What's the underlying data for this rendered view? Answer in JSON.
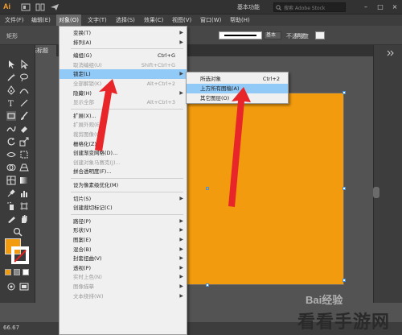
{
  "app": {
    "logo": "Ai",
    "workspace": "基本功能",
    "search_placeholder": "搜索 Adobe Stock"
  },
  "window_controls": [
    "–",
    "□",
    "×"
  ],
  "menubar": [
    "文件(F)",
    "编辑(E)",
    "对象(O)",
    "文字(T)",
    "选择(S)",
    "效果(C)",
    "视图(V)",
    "窗口(W)",
    "帮助(H)"
  ],
  "controlbar": {
    "left_label": "矩形",
    "stroke_style": "基本",
    "opacity_label": "不透明度",
    "style_label": "样式："
  },
  "doc_tab": "未标题",
  "object_menu": [
    {
      "label": "变换(T)",
      "submenu": true,
      "disabled": false
    },
    {
      "label": "排列(A)",
      "submenu": true,
      "disabled": false
    },
    {
      "sep": true
    },
    {
      "label": "编组(G)",
      "shortcut": "Ctrl+G",
      "disabled": false
    },
    {
      "label": "取消编组(U)",
      "shortcut": "Shift+Ctrl+G",
      "disabled": true
    },
    {
      "label": "锁定(L)",
      "submenu": true,
      "disabled": false,
      "highlight": true
    },
    {
      "label": "全部解锁(K)",
      "shortcut": "Alt+Ctrl+2",
      "disabled": true
    },
    {
      "label": "隐藏(H)",
      "submenu": true,
      "disabled": false
    },
    {
      "label": "显示全部",
      "shortcut": "Alt+Ctrl+3",
      "disabled": true
    },
    {
      "sep": true
    },
    {
      "label": "扩展(X)...",
      "disabled": false
    },
    {
      "label": "扩展外观(E)",
      "disabled": true
    },
    {
      "label": "裁剪图像(C)",
      "disabled": true
    },
    {
      "label": "栅格化(Z)...",
      "disabled": false
    },
    {
      "label": "创建渐变网格(D)...",
      "disabled": false
    },
    {
      "label": "创建对象马赛克(J)...",
      "disabled": true
    },
    {
      "label": "拼合透明度(F)...",
      "disabled": false
    },
    {
      "sep": true
    },
    {
      "label": "设为像素级优化(M)",
      "disabled": false
    },
    {
      "sep": true
    },
    {
      "label": "切片(S)",
      "submenu": true,
      "disabled": false
    },
    {
      "label": "创建裁切标记(C)",
      "disabled": false
    },
    {
      "sep": true
    },
    {
      "label": "路径(P)",
      "submenu": true,
      "disabled": false
    },
    {
      "label": "形状(V)",
      "submenu": true,
      "disabled": false
    },
    {
      "label": "图案(E)",
      "submenu": true,
      "disabled": false
    },
    {
      "label": "混合(B)",
      "submenu": true,
      "disabled": false
    },
    {
      "label": "封套扭曲(V)",
      "submenu": true,
      "disabled": false
    },
    {
      "label": "透视(P)",
      "submenu": true,
      "disabled": false
    },
    {
      "label": "实时上色(N)",
      "submenu": true,
      "disabled": true
    },
    {
      "label": "图像描摹",
      "submenu": true,
      "disabled": true
    },
    {
      "label": "文本绕排(W)",
      "submenu": true,
      "disabled": true
    }
  ],
  "lock_submenu": [
    {
      "label": "所选对象",
      "shortcut": "Ctrl+2"
    },
    {
      "label": "上方所有图稿(A)",
      "highlight": true
    },
    {
      "label": "其它图层(O)"
    }
  ],
  "status": {
    "zoom": "66.67"
  },
  "watermark": {
    "text": "看看手游网",
    "baidu": "Bai经验"
  },
  "colors": {
    "fill": "#f29b0e",
    "menu_highlight": "#91c9f7",
    "arrow": "#e8262a"
  }
}
